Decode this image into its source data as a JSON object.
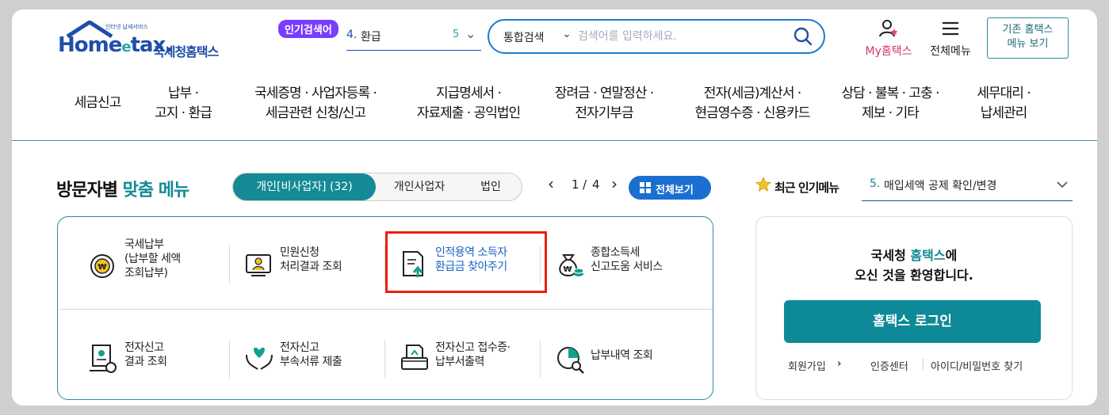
{
  "header": {
    "logo_small": "인터넷 납세서비스",
    "logo_word": "Home",
    "logo_e": "e",
    "logo_tail": "tax.",
    "logo_kr": "국세청홈택스",
    "popular_badge": "인기검색어",
    "popular_rank": "4.",
    "popular_term": "환급",
    "popular_next": "5",
    "search_scope": "통합검색",
    "search_placeholder": "검색어를 입력하세요.",
    "my_hometax": "My홈택스",
    "all_menu": "전체메뉴",
    "legacy_line1": "기존 홈택스",
    "legacy_line2": "메뉴 보기"
  },
  "nav": [
    {
      "l1": "세금신고",
      "l2": ""
    },
    {
      "l1": "납부 ·",
      "l2": "고지 · 환급"
    },
    {
      "l1": "국세증명 · 사업자등록 ·",
      "l2": "세금관련 신청/신고"
    },
    {
      "l1": "지급명세서 ·",
      "l2": "자료제출 · 공익법인"
    },
    {
      "l1": "장려금 · 연말정산 ·",
      "l2": "전자기부금"
    },
    {
      "l1": "전자(세금)계산서 ·",
      "l2": "현금영수증 · 신용카드"
    },
    {
      "l1": "상담 · 불복 · 고충 ·",
      "l2": "제보 · 기타"
    },
    {
      "l1": "세무대리 ·",
      "l2": "납세관리"
    }
  ],
  "visitor": {
    "title_a": "방문자별",
    "title_b": "맞춤 메뉴",
    "tabs": [
      "개인[비사업자] (32)",
      "개인사업자",
      "법인"
    ],
    "page_current": "1",
    "page_sep": "/",
    "page_total": "4",
    "see_all": "전체보기",
    "items": [
      {
        "text": "국세납부\n(납부할 세액\n조회납부)"
      },
      {
        "text": "민원신청\n처리결과 조회"
      },
      {
        "text": "인적용역 소득자\n환급금 찾아주기"
      },
      {
        "text": "종합소득세\n신고도움 서비스"
      },
      {
        "text": "전자신고\n결과 조회"
      },
      {
        "text": "전자신고\n부속서류 제출"
      },
      {
        "text": "전자신고 접수증·\n납부서출력"
      },
      {
        "text": "납부내역 조회"
      }
    ]
  },
  "recent": {
    "label": "최근 인기메뉴",
    "rank": "5.",
    "value": "매입세액 공제 확인/변경"
  },
  "login": {
    "welcome_a": "국세청 ",
    "welcome_brand": "홈택스",
    "welcome_b": "에",
    "welcome_line2": "오신 것을 환영합니다.",
    "button": "홈택스 로그인",
    "signup": "회원가입",
    "cert": "인증센터",
    "find": "아이디/비밀번호 찾기"
  },
  "colors": {
    "primary": "#148a96",
    "brand_blue": "#1f4fa8",
    "highlight": "#e8210f",
    "badge": "#7a3cff"
  }
}
